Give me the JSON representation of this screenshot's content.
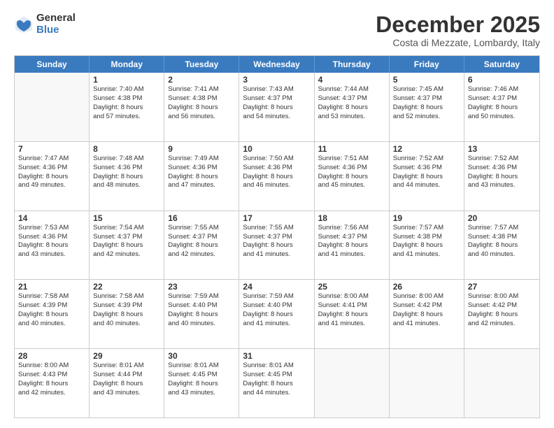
{
  "header": {
    "logo_general": "General",
    "logo_blue": "Blue",
    "month_title": "December 2025",
    "location": "Costa di Mezzate, Lombardy, Italy"
  },
  "weekdays": [
    "Sunday",
    "Monday",
    "Tuesday",
    "Wednesday",
    "Thursday",
    "Friday",
    "Saturday"
  ],
  "rows": [
    [
      {
        "day": "",
        "info": ""
      },
      {
        "day": "1",
        "info": "Sunrise: 7:40 AM\nSunset: 4:38 PM\nDaylight: 8 hours\nand 57 minutes."
      },
      {
        "day": "2",
        "info": "Sunrise: 7:41 AM\nSunset: 4:38 PM\nDaylight: 8 hours\nand 56 minutes."
      },
      {
        "day": "3",
        "info": "Sunrise: 7:43 AM\nSunset: 4:37 PM\nDaylight: 8 hours\nand 54 minutes."
      },
      {
        "day": "4",
        "info": "Sunrise: 7:44 AM\nSunset: 4:37 PM\nDaylight: 8 hours\nand 53 minutes."
      },
      {
        "day": "5",
        "info": "Sunrise: 7:45 AM\nSunset: 4:37 PM\nDaylight: 8 hours\nand 52 minutes."
      },
      {
        "day": "6",
        "info": "Sunrise: 7:46 AM\nSunset: 4:37 PM\nDaylight: 8 hours\nand 50 minutes."
      }
    ],
    [
      {
        "day": "7",
        "info": "Sunrise: 7:47 AM\nSunset: 4:36 PM\nDaylight: 8 hours\nand 49 minutes."
      },
      {
        "day": "8",
        "info": "Sunrise: 7:48 AM\nSunset: 4:36 PM\nDaylight: 8 hours\nand 48 minutes."
      },
      {
        "day": "9",
        "info": "Sunrise: 7:49 AM\nSunset: 4:36 PM\nDaylight: 8 hours\nand 47 minutes."
      },
      {
        "day": "10",
        "info": "Sunrise: 7:50 AM\nSunset: 4:36 PM\nDaylight: 8 hours\nand 46 minutes."
      },
      {
        "day": "11",
        "info": "Sunrise: 7:51 AM\nSunset: 4:36 PM\nDaylight: 8 hours\nand 45 minutes."
      },
      {
        "day": "12",
        "info": "Sunrise: 7:52 AM\nSunset: 4:36 PM\nDaylight: 8 hours\nand 44 minutes."
      },
      {
        "day": "13",
        "info": "Sunrise: 7:52 AM\nSunset: 4:36 PM\nDaylight: 8 hours\nand 43 minutes."
      }
    ],
    [
      {
        "day": "14",
        "info": "Sunrise: 7:53 AM\nSunset: 4:36 PM\nDaylight: 8 hours\nand 43 minutes."
      },
      {
        "day": "15",
        "info": "Sunrise: 7:54 AM\nSunset: 4:37 PM\nDaylight: 8 hours\nand 42 minutes."
      },
      {
        "day": "16",
        "info": "Sunrise: 7:55 AM\nSunset: 4:37 PM\nDaylight: 8 hours\nand 42 minutes."
      },
      {
        "day": "17",
        "info": "Sunrise: 7:55 AM\nSunset: 4:37 PM\nDaylight: 8 hours\nand 41 minutes."
      },
      {
        "day": "18",
        "info": "Sunrise: 7:56 AM\nSunset: 4:37 PM\nDaylight: 8 hours\nand 41 minutes."
      },
      {
        "day": "19",
        "info": "Sunrise: 7:57 AM\nSunset: 4:38 PM\nDaylight: 8 hours\nand 41 minutes."
      },
      {
        "day": "20",
        "info": "Sunrise: 7:57 AM\nSunset: 4:38 PM\nDaylight: 8 hours\nand 40 minutes."
      }
    ],
    [
      {
        "day": "21",
        "info": "Sunrise: 7:58 AM\nSunset: 4:39 PM\nDaylight: 8 hours\nand 40 minutes."
      },
      {
        "day": "22",
        "info": "Sunrise: 7:58 AM\nSunset: 4:39 PM\nDaylight: 8 hours\nand 40 minutes."
      },
      {
        "day": "23",
        "info": "Sunrise: 7:59 AM\nSunset: 4:40 PM\nDaylight: 8 hours\nand 40 minutes."
      },
      {
        "day": "24",
        "info": "Sunrise: 7:59 AM\nSunset: 4:40 PM\nDaylight: 8 hours\nand 41 minutes."
      },
      {
        "day": "25",
        "info": "Sunrise: 8:00 AM\nSunset: 4:41 PM\nDaylight: 8 hours\nand 41 minutes."
      },
      {
        "day": "26",
        "info": "Sunrise: 8:00 AM\nSunset: 4:42 PM\nDaylight: 8 hours\nand 41 minutes."
      },
      {
        "day": "27",
        "info": "Sunrise: 8:00 AM\nSunset: 4:42 PM\nDaylight: 8 hours\nand 42 minutes."
      }
    ],
    [
      {
        "day": "28",
        "info": "Sunrise: 8:00 AM\nSunset: 4:43 PM\nDaylight: 8 hours\nand 42 minutes."
      },
      {
        "day": "29",
        "info": "Sunrise: 8:01 AM\nSunset: 4:44 PM\nDaylight: 8 hours\nand 43 minutes."
      },
      {
        "day": "30",
        "info": "Sunrise: 8:01 AM\nSunset: 4:45 PM\nDaylight: 8 hours\nand 43 minutes."
      },
      {
        "day": "31",
        "info": "Sunrise: 8:01 AM\nSunset: 4:45 PM\nDaylight: 8 hours\nand 44 minutes."
      },
      {
        "day": "",
        "info": ""
      },
      {
        "day": "",
        "info": ""
      },
      {
        "day": "",
        "info": ""
      }
    ]
  ]
}
